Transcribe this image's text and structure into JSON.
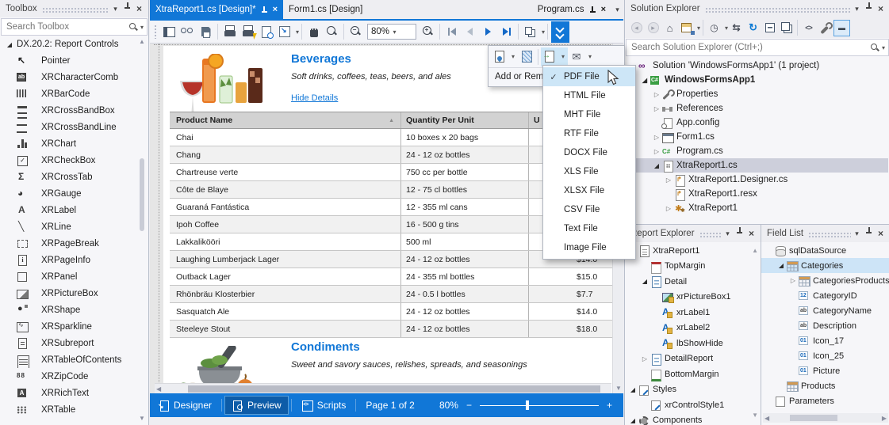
{
  "colors": {
    "accent": "#1177d7",
    "tab_active": "#1177d7",
    "menu_highlight": "#cde6f7",
    "selection_gray": "#cdcfdb",
    "selection_blue": "#cde4f7",
    "title_blue": "#1177d7"
  },
  "toolbox": {
    "title": "Toolbox",
    "search_placeholder": "Search Toolbox",
    "group": "DX.20.2: Report Controls",
    "items": [
      {
        "label": "Pointer",
        "icon": "pointer"
      },
      {
        "label": "XRCharacterComb",
        "icon": "character-comb"
      },
      {
        "label": "XRBarCode",
        "icon": "barcode"
      },
      {
        "label": "XRCrossBandBox",
        "icon": "crossband-box"
      },
      {
        "label": "XRCrossBandLine",
        "icon": "crossband-line"
      },
      {
        "label": "XRChart",
        "icon": "chart"
      },
      {
        "label": "XRCheckBox",
        "icon": "checkbox"
      },
      {
        "label": "XRCrossTab",
        "icon": "crosstab"
      },
      {
        "label": "XRGauge",
        "icon": "gauge"
      },
      {
        "label": "XRLabel",
        "icon": "label"
      },
      {
        "label": "XRLine",
        "icon": "line"
      },
      {
        "label": "XRPageBreak",
        "icon": "pagebreak"
      },
      {
        "label": "XRPageInfo",
        "icon": "pageinfo"
      },
      {
        "label": "XRPanel",
        "icon": "panel"
      },
      {
        "label": "XRPictureBox",
        "icon": "picturebox"
      },
      {
        "label": "XRShape",
        "icon": "shape"
      },
      {
        "label": "XRSparkline",
        "icon": "sparkline"
      },
      {
        "label": "XRSubreport",
        "icon": "subreport"
      },
      {
        "label": "XRTableOfContents",
        "icon": "toc"
      },
      {
        "label": "XRZipCode",
        "icon": "zipcode"
      },
      {
        "label": "XRRichText",
        "icon": "richtext"
      },
      {
        "label": "XRTable",
        "icon": "table"
      }
    ]
  },
  "tabs": {
    "doc1": "XtraReport1.cs [Design]*",
    "doc2": "Form1.cs [Design]",
    "doc3": "Program.cs"
  },
  "preview_toolbar": {
    "zoom": "80%"
  },
  "export_popup": {
    "add_remove": "Add or Rem"
  },
  "export_menu": {
    "items": [
      {
        "label": "PDF File",
        "check": "✓",
        "cls": "hl"
      },
      {
        "label": "HTML File"
      },
      {
        "label": "MHT File"
      },
      {
        "label": "RTF File"
      },
      {
        "label": "DOCX File"
      },
      {
        "label": "XLS File"
      },
      {
        "label": "XLSX File"
      },
      {
        "label": "CSV File"
      },
      {
        "label": "Text File"
      },
      {
        "label": "Image File"
      }
    ]
  },
  "report": {
    "group1": {
      "title": "Beverages",
      "subtitle": "Soft drinks, coffees, teas, beers, and ales",
      "link": "Hide Details"
    },
    "table": {
      "headers": {
        "name": "Product Name",
        "qty": "Quantity Per Unit",
        "price": "U"
      },
      "rows": [
        {
          "name": "Chai",
          "qty": "10 boxes x 20 bags",
          "price": ""
        },
        {
          "name": "Chang",
          "qty": "24 - 12 oz bottles",
          "price": ""
        },
        {
          "name": "Chartreuse verte",
          "qty": "750 cc per bottle",
          "price": ""
        },
        {
          "name": "Côte de Blaye",
          "qty": "12 - 75 cl bottles",
          "price": ""
        },
        {
          "name": "Guaraná Fantástica",
          "qty": "12 - 355 ml cans",
          "price": ""
        },
        {
          "name": "Ipoh Coffee",
          "qty": "16 - 500 g tins",
          "price": ""
        },
        {
          "name": "Lakkalikööri",
          "qty": "500 ml",
          "price": ""
        },
        {
          "name": "Laughing Lumberjack Lager",
          "qty": "24 - 12 oz bottles",
          "price": "$14.0"
        },
        {
          "name": "Outback Lager",
          "qty": "24 - 355 ml bottles",
          "price": "$15.0"
        },
        {
          "name": "Rhönbräu Klosterbier",
          "qty": "24 - 0.5 l bottles",
          "price": "$7.7"
        },
        {
          "name": "Sasquatch Ale",
          "qty": "24 - 12 oz bottles",
          "price": "$14.0"
        },
        {
          "name": "Steeleye Stout",
          "qty": "24 - 12 oz bottles",
          "price": "$18.0"
        }
      ]
    },
    "group2": {
      "title": "Condiments",
      "subtitle": "Sweet and savory sauces, relishes, spreads, and seasonings"
    }
  },
  "statusbar": {
    "designer": "Designer",
    "preview": "Preview",
    "scripts": "Scripts",
    "page": "Page 1 of 2",
    "zoom": "80%",
    "zoom_out": "−",
    "zoom_in": "+"
  },
  "solution_explorer": {
    "title": "Solution Explorer",
    "search_placeholder": "Search Solution Explorer (Ctrl+;)",
    "tree": [
      {
        "label": "Solution 'WindowsFormsApp1' (1 project)",
        "icon": "vs-solution",
        "level": 0
      },
      {
        "label": "WindowsFormsApp1",
        "icon": "csharp-project",
        "level": 1,
        "exp": "e",
        "cls": "bold"
      },
      {
        "label": "Properties",
        "icon": "wrench",
        "level": 2,
        "exp": "c"
      },
      {
        "label": "References",
        "icon": "references",
        "level": 2,
        "exp": "c"
      },
      {
        "label": "App.config",
        "icon": "config",
        "level": 2
      },
      {
        "label": "Form1.cs",
        "icon": "winform",
        "level": 2,
        "exp": "c"
      },
      {
        "label": "Program.cs",
        "icon": "csharp-file",
        "level": 2,
        "exp": "c"
      },
      {
        "label": "XtraReport1.cs",
        "icon": "report-file",
        "level": 2,
        "exp": "e",
        "cls": "sel"
      },
      {
        "label": "XtraReport1.Designer.cs",
        "icon": "designer-file",
        "level": 3,
        "exp": "c"
      },
      {
        "label": "XtraReport1.resx",
        "icon": "resx-file",
        "level": 3
      },
      {
        "label": "XtraReport1",
        "icon": "component",
        "level": 3,
        "exp": "c"
      }
    ]
  },
  "report_explorer": {
    "title": "Report Explorer",
    "tree": [
      {
        "label": "XtraReport1",
        "icon": "report",
        "level": 0,
        "exp": "e"
      },
      {
        "label": "TopMargin",
        "icon": "topmargin",
        "level": 1
      },
      {
        "label": "Detail",
        "icon": "band",
        "level": 1,
        "exp": "e"
      },
      {
        "label": "xrPictureBox1",
        "icon": "picture-ctl",
        "level": 2
      },
      {
        "label": "xrLabel1",
        "icon": "label-ctl",
        "level": 2
      },
      {
        "label": "xrLabel2",
        "icon": "label-ctl",
        "level": 2
      },
      {
        "label": "lbShowHide",
        "icon": "label-ctl",
        "level": 2
      },
      {
        "label": "DetailReport",
        "icon": "band",
        "level": 1,
        "exp": "c"
      },
      {
        "label": "BottomMargin",
        "icon": "bottommargin",
        "level": 1
      },
      {
        "label": "Styles",
        "icon": "styles",
        "level": 0,
        "exp": "e"
      },
      {
        "label": "xrControlStyle1",
        "icon": "style",
        "level": 1
      },
      {
        "label": "Components",
        "icon": "gear",
        "level": 0,
        "exp": "e"
      }
    ]
  },
  "field_list": {
    "title": "Field List",
    "tree": [
      {
        "label": "sqlDataSource",
        "icon": "datasource",
        "level": 0
      },
      {
        "label": "Categories",
        "icon": "dbtable",
        "level": 1,
        "exp": "e",
        "cls": "sel2"
      },
      {
        "label": "CategoriesProducts",
        "icon": "dbtable",
        "level": 2,
        "exp": "c"
      },
      {
        "label": "CategoryID",
        "icon": "num",
        "level": 2
      },
      {
        "label": "CategoryName",
        "icon": "str",
        "level": 2
      },
      {
        "label": "Description",
        "icon": "str",
        "level": 2
      },
      {
        "label": "Icon_17",
        "icon": "bin",
        "level": 2
      },
      {
        "label": "Icon_25",
        "icon": "bin",
        "level": 2
      },
      {
        "label": "Picture",
        "icon": "bin",
        "level": 2
      },
      {
        "label": "Products",
        "icon": "dbtable",
        "level": 1
      },
      {
        "label": "Parameters",
        "icon": "params",
        "level": 0
      }
    ]
  }
}
